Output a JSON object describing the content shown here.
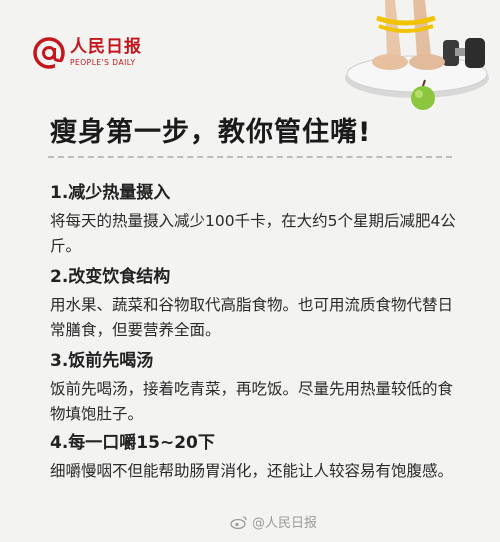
{
  "logo": {
    "name_cn": "人民日报",
    "name_en": "PEOPLE'S DAILY"
  },
  "title": "瘦身第一步，教你管住嘴!",
  "sections": [
    {
      "heading": "1.减少热量摄入",
      "body": "将每天的热量摄入减少100千卡，在大约5个星期后减肥4公斤。"
    },
    {
      "heading": "2.改变饮食结构",
      "body": "用水果、蔬菜和谷物取代高脂食物。也可用流质食物代替日常膳食，但要营养全面。"
    },
    {
      "heading": "3.饭前先喝汤",
      "body": "饭前先喝汤，接着吃青菜，再吃饭。尽量先用热量较低的食物填饱肚子。"
    },
    {
      "heading": "4.每一口嚼15~20下",
      "body": "细嚼慢咽不但能帮助肠胃消化，还能让人较容易有饱腹感。"
    }
  ],
  "watermark": "@人民日报",
  "colors": {
    "brand_red": "#c4161c",
    "background": "#f3f3f1",
    "apple_green": "#8cc63f"
  },
  "icons": [
    "at-sign-logo-icon",
    "weibo-icon"
  ]
}
